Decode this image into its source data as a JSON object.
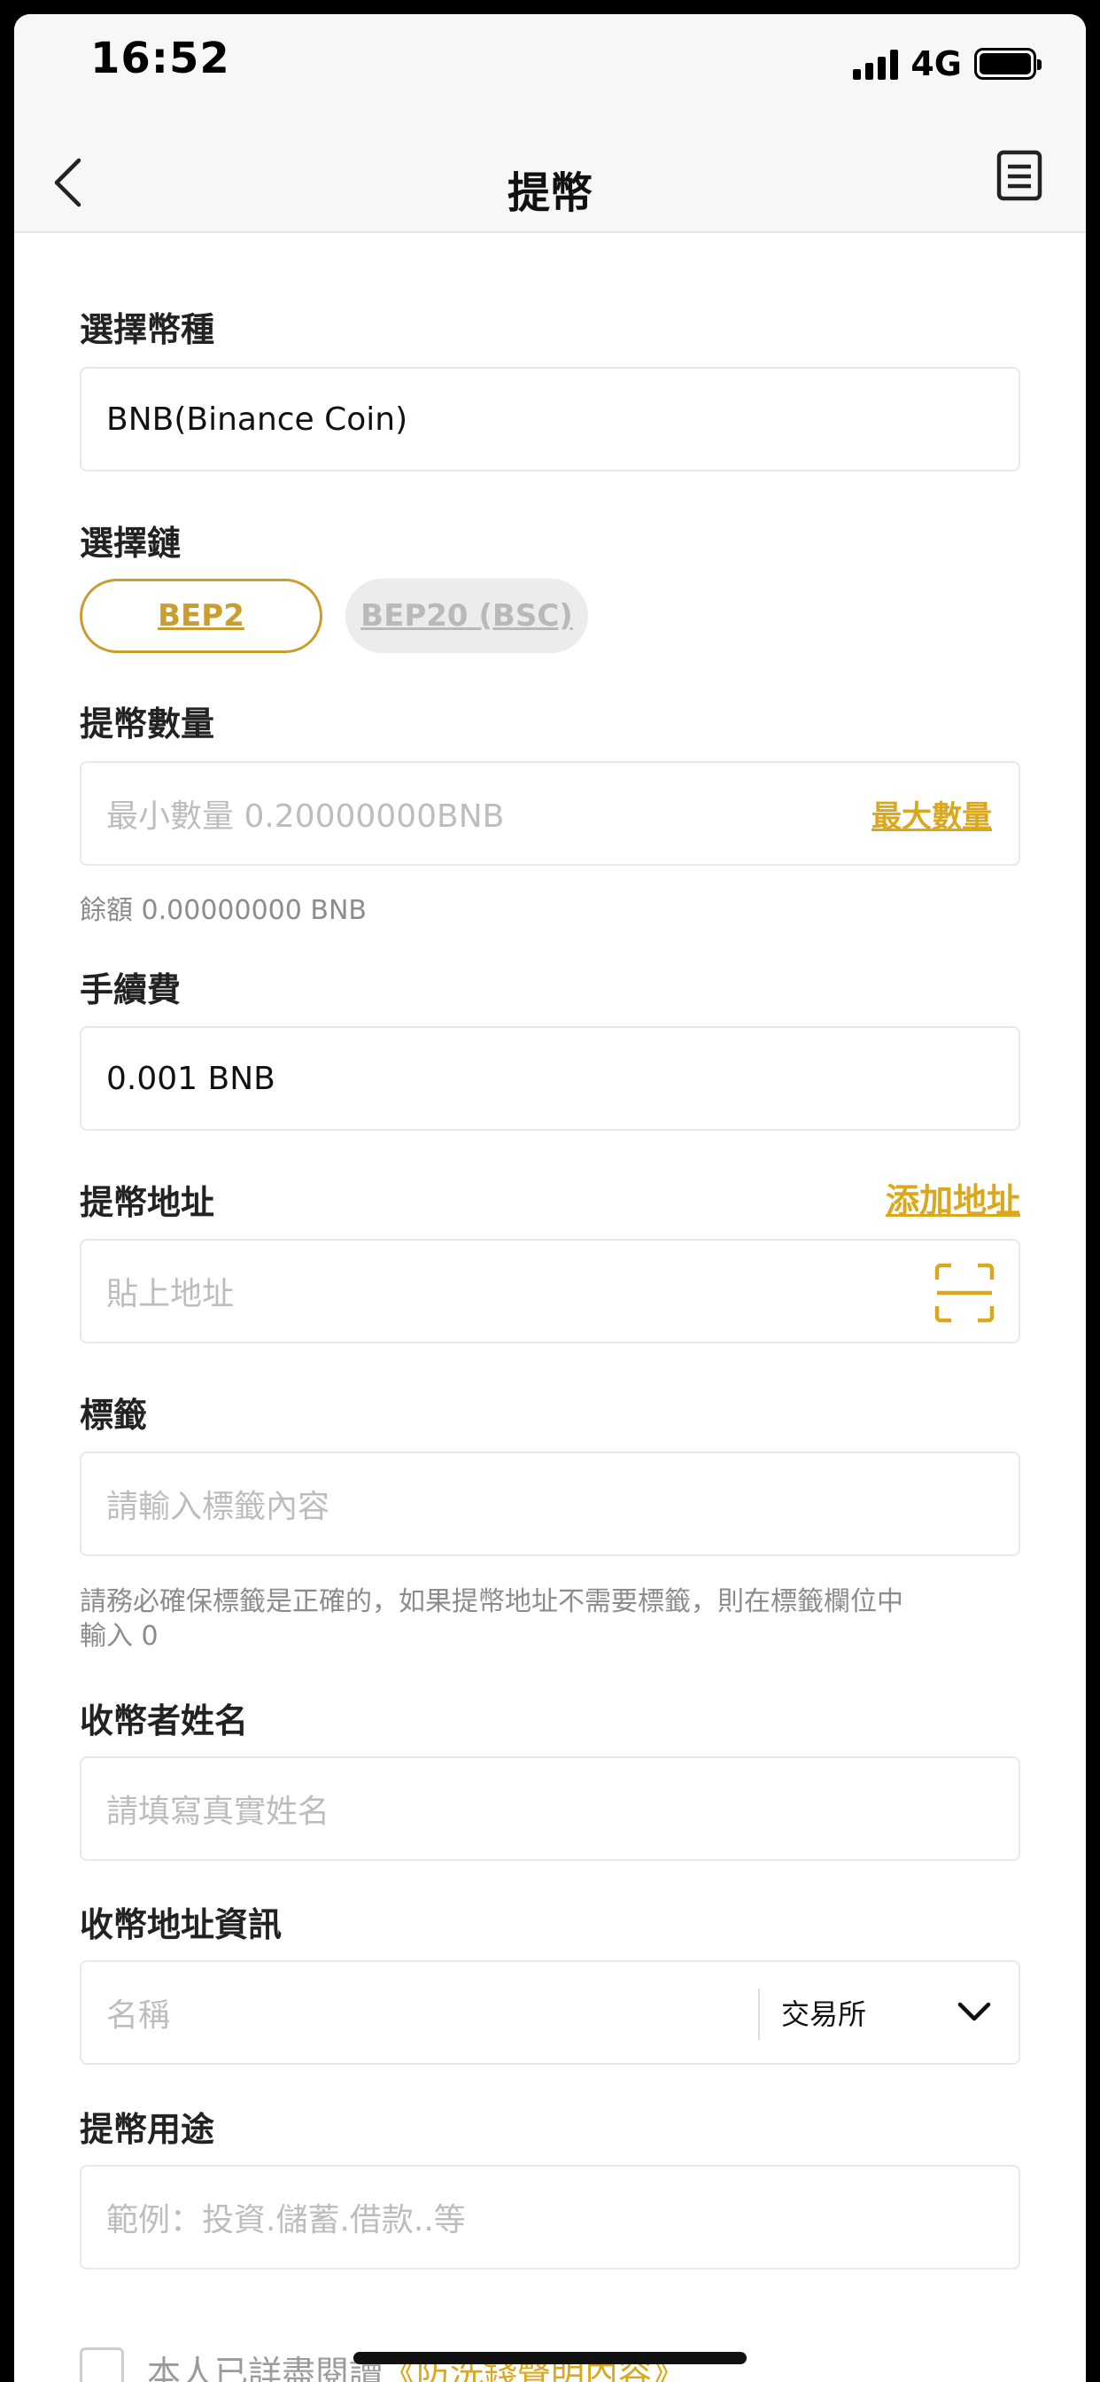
{
  "status_bar": {
    "time": "16:52",
    "network": "4G"
  },
  "nav": {
    "title": "提幣"
  },
  "coin": {
    "label": "選擇幣種",
    "value": "BNB(Binance Coin)"
  },
  "chain": {
    "label": "選擇鏈",
    "options": [
      "BEP2",
      "BEP20 (BSC)"
    ],
    "selected": "BEP2"
  },
  "amount": {
    "label": "提幣數量",
    "placeholder": "最小數量 0.20000000BNB",
    "max_label": "最大數量",
    "balance": "餘額 0.00000000 BNB"
  },
  "fee": {
    "label": "手續費",
    "value": "0.001 BNB"
  },
  "address": {
    "label": "提幣地址",
    "add_label": "添加地址",
    "placeholder": "貼上地址"
  },
  "tag": {
    "label": "標籤",
    "placeholder": "請輸入標籤內容",
    "hint_line1": "請務必確保標籤是正確的，如果提幣地址不需要標籤，則在標籤欄位中",
    "hint_line2": "輸入 0"
  },
  "recipient_name": {
    "label": "收幣者姓名",
    "placeholder": "請填寫真實姓名"
  },
  "recipient_info": {
    "label": "收幣地址資訊",
    "name_placeholder": "名稱",
    "type_value": "交易所"
  },
  "purpose": {
    "label": "提幣用途",
    "placeholder": "範例：投資.儲蓄.借款..等"
  },
  "agreement": {
    "prefix": "本人已詳盡閱讀",
    "link": "《防洗錢聲明內容》"
  },
  "colors": {
    "accent": "#d9a81c",
    "chain_border": "#c99d2e"
  }
}
